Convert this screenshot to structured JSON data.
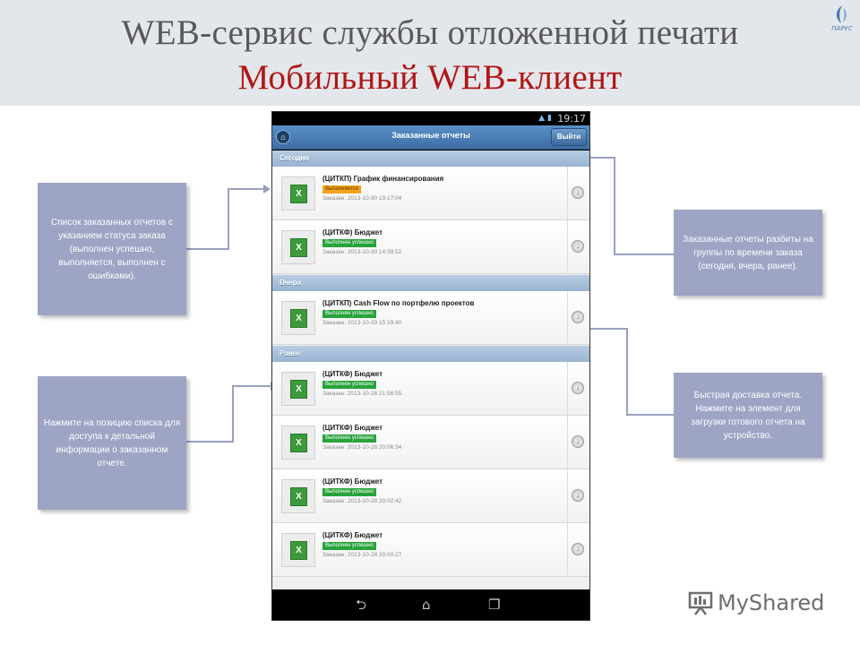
{
  "slide": {
    "title_line1": "WEB-сервис службы отложенной печати",
    "title_line2": "Мобильный WEB-клиент",
    "logo_text": "ПАРУС"
  },
  "phone": {
    "status_time": "19:17",
    "app_title": "Заказанные отчеты",
    "exit_label": "Выйти",
    "groups": [
      {
        "label": "Сегодня",
        "items": [
          {
            "title": "(ЦИТКП) График финансирования",
            "status": "Выполняется",
            "status_type": "running",
            "date": "Заказан: 2013-10-30 19:17:04"
          },
          {
            "title": "(ЦИТКФ) Бюджет",
            "status": "Выполнен успешно",
            "status_type": "success",
            "date": "Заказан: 2013-10-30 14:39:52"
          }
        ]
      },
      {
        "label": "Вчера",
        "items": [
          {
            "title": "(ЦИТКП) Cash Flow по портфелю проектов",
            "status": "Выполнен успешно",
            "status_type": "success",
            "date": "Заказан: 2013-10-29 15:19:40"
          }
        ]
      },
      {
        "label": "Ранее",
        "items": [
          {
            "title": "(ЦИТКФ) Бюджет",
            "status": "Выполнен успешно",
            "status_type": "success",
            "date": "Заказан: 2013-10-28 21:56:55"
          },
          {
            "title": "(ЦИТКФ) Бюджет",
            "status": "Выполнен успешно",
            "status_type": "success",
            "date": "Заказан: 2013-10-28 20:06:34"
          },
          {
            "title": "(ЦИТКФ) Бюджет",
            "status": "Выполнен успешно",
            "status_type": "success",
            "date": "Заказан: 2013-10-28 20:02:42"
          },
          {
            "title": "(ЦИТКФ) Бюджет",
            "status": "Выполнен успешно",
            "status_type": "success",
            "date": "Заказан: 2013-10-28 20:00:27"
          }
        ]
      }
    ]
  },
  "callouts": {
    "list_status": "Список заказанных отчетов с указанием статуса заказа (выполнен успешно, выполняется, выполнен с ошибками).",
    "tap_item": "Нажмите на позицию списка для доступа к детальной информации о заказанном отчете.",
    "grouping": "Заказанные отчеты разбиты на группы по времени заказа (сегодня, вчера, ранее).",
    "download": "Быстрая доставка отчета. Нажмите на элемент для загрузки готового отчета на устройство."
  },
  "watermark": "MyShared",
  "colors": {
    "title_gray": "#595959",
    "title_red": "#b01616",
    "callout_bg": "#9ea4c4",
    "status_success": "#27a33a",
    "status_running": "#f5a21a"
  }
}
